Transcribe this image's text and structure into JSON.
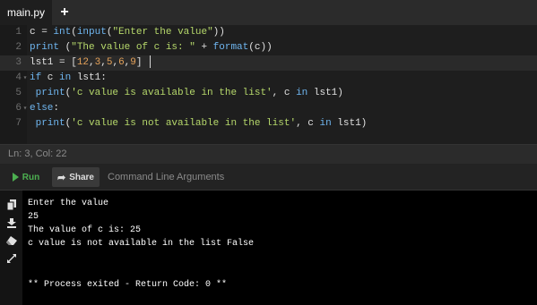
{
  "tab": {
    "label": "main.py",
    "add_symbol": "+"
  },
  "editor": {
    "lines": [
      {
        "num": "1",
        "fold": ""
      },
      {
        "num": "2",
        "fold": ""
      },
      {
        "num": "3",
        "fold": ""
      },
      {
        "num": "4",
        "fold": "▾"
      },
      {
        "num": "5",
        "fold": ""
      },
      {
        "num": "6",
        "fold": "▾"
      },
      {
        "num": "7",
        "fold": ""
      }
    ],
    "code": {
      "l1": {
        "a": "c = ",
        "b": "int",
        "c": "(",
        "d": "input",
        "e": "(",
        "f": "\"Enter the value\"",
        "g": "))"
      },
      "l2": {
        "a": "print",
        "b": " (",
        "c": "\"The value of c is: \"",
        "d": " + ",
        "e": "format",
        "f": "(c))"
      },
      "l3": {
        "a": "lst1 = [",
        "b": "12",
        "c": ",",
        "d": "3",
        "e": ",",
        "f": "5",
        "g": ",",
        "h": "6",
        "i": ",",
        "j": "9",
        "k": "]"
      },
      "l4": {
        "a": "if",
        "b": " c ",
        "c": "in",
        "d": " lst1:"
      },
      "l5": {
        "a": " print",
        "b": "(",
        "c": "'c value is available in the list'",
        "d": ", c ",
        "e": "in",
        "f": " lst1)"
      },
      "l6": {
        "a": "else",
        "b": ":"
      },
      "l7": {
        "a": " print",
        "b": "(",
        "c": "'c value is not available in the list'",
        "d": ", c ",
        "e": "in",
        "f": " lst1)"
      }
    }
  },
  "status": {
    "text": "Ln: 3,  Col: 22"
  },
  "toolbar": {
    "run_label": "Run",
    "share_label": "Share",
    "args_placeholder": "Command Line Arguments"
  },
  "console": {
    "lines": [
      "Enter the value",
      "25",
      "The value of c is: 25",
      "c value is not available in the list False",
      "",
      "",
      "** Process exited - Return Code: 0 **"
    ]
  },
  "colors": {
    "keyword": "#6fb6f0",
    "string": "#b6d86b",
    "number": "#e5a25a",
    "run": "#4caf50"
  }
}
